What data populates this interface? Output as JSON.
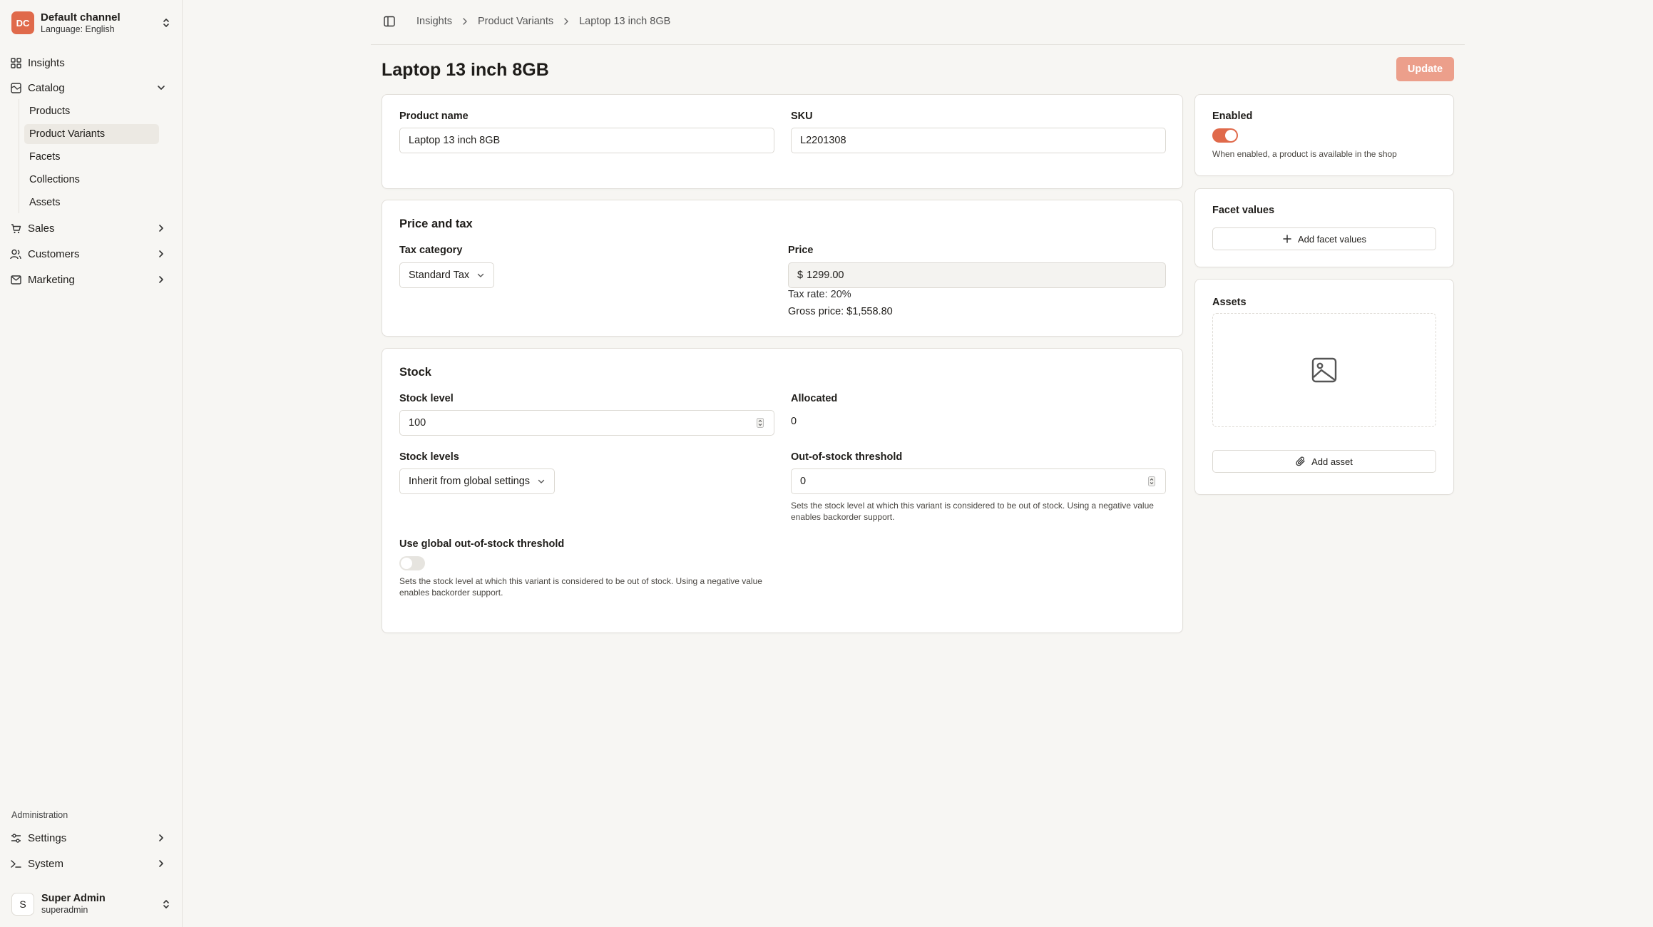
{
  "channel": {
    "badge": "DC",
    "name": "Default channel",
    "language": "Language: English"
  },
  "nav": {
    "insights": "Insights",
    "catalog": "Catalog",
    "catalog_items": [
      "Products",
      "Product Variants",
      "Facets",
      "Collections",
      "Assets"
    ],
    "sales": "Sales",
    "customers": "Customers",
    "marketing": "Marketing",
    "administration_label": "Administration",
    "settings": "Settings",
    "system": "System"
  },
  "user": {
    "initial": "S",
    "name": "Super Admin",
    "username": "superadmin"
  },
  "breadcrumb": [
    "Insights",
    "Product Variants",
    "Laptop 13 inch 8GB"
  ],
  "page": {
    "title": "Laptop 13 inch 8GB",
    "update_label": "Update"
  },
  "details": {
    "product_name_label": "Product name",
    "product_name_value": "Laptop 13 inch 8GB",
    "sku_label": "SKU",
    "sku_value": "L2201308"
  },
  "price": {
    "section_title": "Price and tax",
    "tax_category_label": "Tax category",
    "tax_category_value": "Standard Tax",
    "price_label": "Price",
    "currency_symbol": "$",
    "price_value": "1299.00",
    "tax_rate": "Tax rate: 20%",
    "gross_price": "Gross price: $1,558.80"
  },
  "stock": {
    "section_title": "Stock",
    "stock_level_label": "Stock level",
    "stock_level_value": "100",
    "allocated_label": "Allocated",
    "allocated_value": "0",
    "stock_levels_label": "Stock levels",
    "stock_levels_value": "Inherit from global settings",
    "threshold_label": "Out-of-stock threshold",
    "threshold_value": "0",
    "threshold_help": "Sets the stock level at which this variant is considered to be out of stock. Using a negative value enables backorder support.",
    "global_threshold_label": "Use global out-of-stock threshold",
    "global_threshold_enabled": false,
    "global_threshold_help": "Sets the stock level at which this variant is considered to be out of stock. Using a negative value enables backorder support."
  },
  "enabled": {
    "label": "Enabled",
    "value": true,
    "help": "When enabled, a product is available in the shop"
  },
  "facets": {
    "title": "Facet values",
    "add_label": "Add facet values"
  },
  "assets": {
    "title": "Assets",
    "add_label": "Add asset"
  },
  "colors": {
    "accent": "#e06a4b",
    "accent_disabled": "#ec9f8b",
    "background": "#f7f6f3"
  }
}
